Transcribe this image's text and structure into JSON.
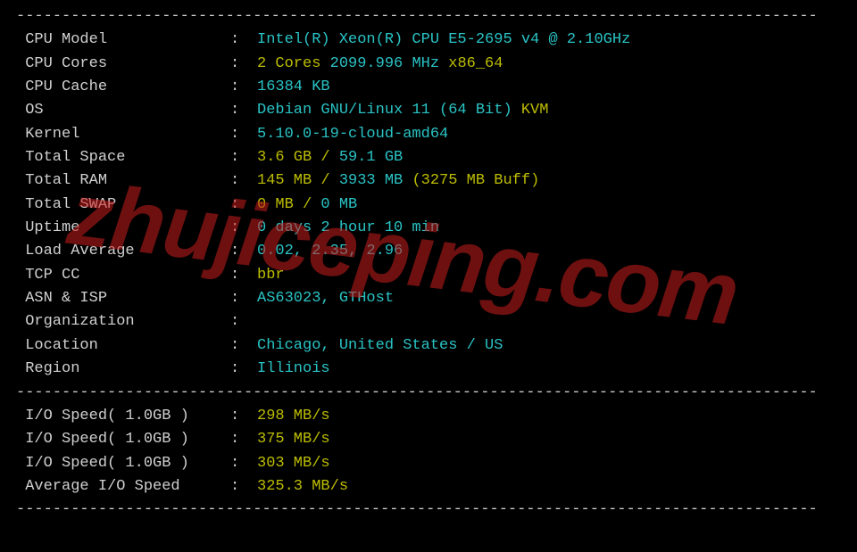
{
  "hr": "----------------------------------------------------------------------------------------",
  "rows1": [
    {
      "label": "CPU Model",
      "parts": [
        {
          "t": "Intel(R) Xeon(R) CPU E5-2695 v4 @ 2.10GHz",
          "c": "cyan"
        }
      ]
    },
    {
      "label": "CPU Cores",
      "parts": [
        {
          "t": "2 Cores ",
          "c": "yellow"
        },
        {
          "t": "2099.996 MHz ",
          "c": "cyan"
        },
        {
          "t": "x86_64",
          "c": "yellow"
        }
      ]
    },
    {
      "label": "CPU Cache",
      "parts": [
        {
          "t": "16384 KB",
          "c": "cyan"
        }
      ]
    },
    {
      "label": "OS",
      "parts": [
        {
          "t": "Debian GNU/Linux 11 (64 Bit) ",
          "c": "cyan"
        },
        {
          "t": "KVM",
          "c": "yellow"
        }
      ]
    },
    {
      "label": "Kernel",
      "parts": [
        {
          "t": "5.10.0-19-cloud-amd64",
          "c": "cyan"
        }
      ]
    },
    {
      "label": "Total Space",
      "parts": [
        {
          "t": "3.6 GB / ",
          "c": "yellow"
        },
        {
          "t": "59.1 GB",
          "c": "cyan"
        }
      ]
    },
    {
      "label": "Total RAM",
      "parts": [
        {
          "t": "145 MB / ",
          "c": "yellow"
        },
        {
          "t": "3933 MB ",
          "c": "cyan"
        },
        {
          "t": "(3275 MB Buff)",
          "c": "yellow"
        }
      ]
    },
    {
      "label": "Total SWAP",
      "parts": [
        {
          "t": "0 MB / ",
          "c": "yellow"
        },
        {
          "t": "0 MB",
          "c": "cyan"
        }
      ]
    },
    {
      "label": "Uptime",
      "parts": [
        {
          "t": "0 days 2 hour 10 min",
          "c": "cyan"
        }
      ]
    },
    {
      "label": "Load Average",
      "parts": [
        {
          "t": "0.02, 2.35, 2.96",
          "c": "cyan"
        }
      ]
    },
    {
      "label": "TCP CC",
      "parts": [
        {
          "t": "bbr",
          "c": "yellow"
        }
      ]
    },
    {
      "label": "ASN & ISP",
      "parts": [
        {
          "t": "AS63023, GTHost",
          "c": "cyan"
        }
      ]
    },
    {
      "label": "Organization",
      "parts": []
    },
    {
      "label": "Location",
      "parts": [
        {
          "t": "Chicago, United States / US",
          "c": "cyan"
        }
      ]
    },
    {
      "label": "Region",
      "parts": [
        {
          "t": "Illinois",
          "c": "cyan"
        }
      ]
    }
  ],
  "rows2": [
    {
      "label": "I/O Speed( 1.0GB )",
      "parts": [
        {
          "t": "298 MB/s",
          "c": "yellow"
        }
      ]
    },
    {
      "label": "I/O Speed( 1.0GB )",
      "parts": [
        {
          "t": "375 MB/s",
          "c": "yellow"
        }
      ]
    },
    {
      "label": "I/O Speed( 1.0GB )",
      "parts": [
        {
          "t": "303 MB/s",
          "c": "yellow"
        }
      ]
    },
    {
      "label": "Average I/O Speed",
      "parts": [
        {
          "t": "325.3 MB/s",
          "c": "yellow"
        }
      ]
    }
  ],
  "watermark": "zhujiceping.com"
}
